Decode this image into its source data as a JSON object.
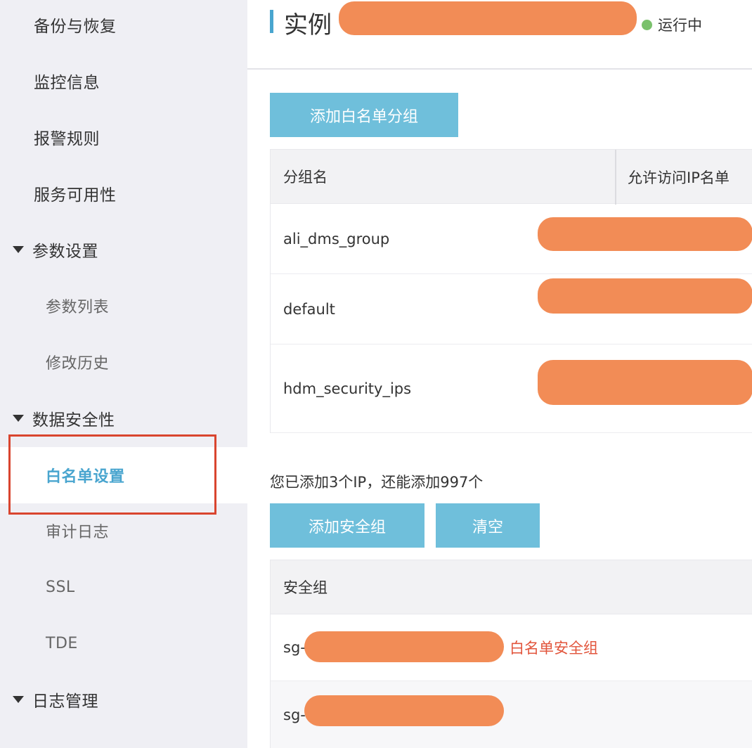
{
  "sidebar": {
    "items": [
      {
        "label": "备份与恢复"
      },
      {
        "label": "监控信息"
      },
      {
        "label": "报警规则"
      },
      {
        "label": "服务可用性"
      },
      {
        "label": "参数设置"
      },
      {
        "label": "参数列表"
      },
      {
        "label": "修改历史"
      },
      {
        "label": "数据安全性"
      },
      {
        "label": "白名单设置"
      },
      {
        "label": "审计日志"
      },
      {
        "label": "SSL"
      },
      {
        "label": "TDE"
      },
      {
        "label": "日志管理"
      }
    ],
    "active_item": "白名单设置"
  },
  "header": {
    "title": "实例",
    "status": "运行中",
    "status_color": "#7ac16c"
  },
  "whitelist": {
    "add_group_button": "添加白名单分组",
    "columns": [
      "分组名",
      "允许访问IP名单"
    ],
    "rows": [
      {
        "name": "ali_dms_group"
      },
      {
        "name": "default"
      },
      {
        "name": "hdm_security_ips"
      }
    ]
  },
  "security_group": {
    "info": "您已添加3个IP，还能添加997个",
    "add_button": "添加安全组",
    "clear_button": "清空",
    "column": "安全组",
    "rows": [
      {
        "prefix": "sg-",
        "note": "白名单安全组"
      },
      {
        "prefix": "sg-",
        "note": ""
      }
    ]
  },
  "colors": {
    "accent": "#49a5cf",
    "button": "#6fbfdb",
    "highlight_border": "#d9452f",
    "redaction": "#f28c56",
    "note_red": "#e2553c"
  }
}
